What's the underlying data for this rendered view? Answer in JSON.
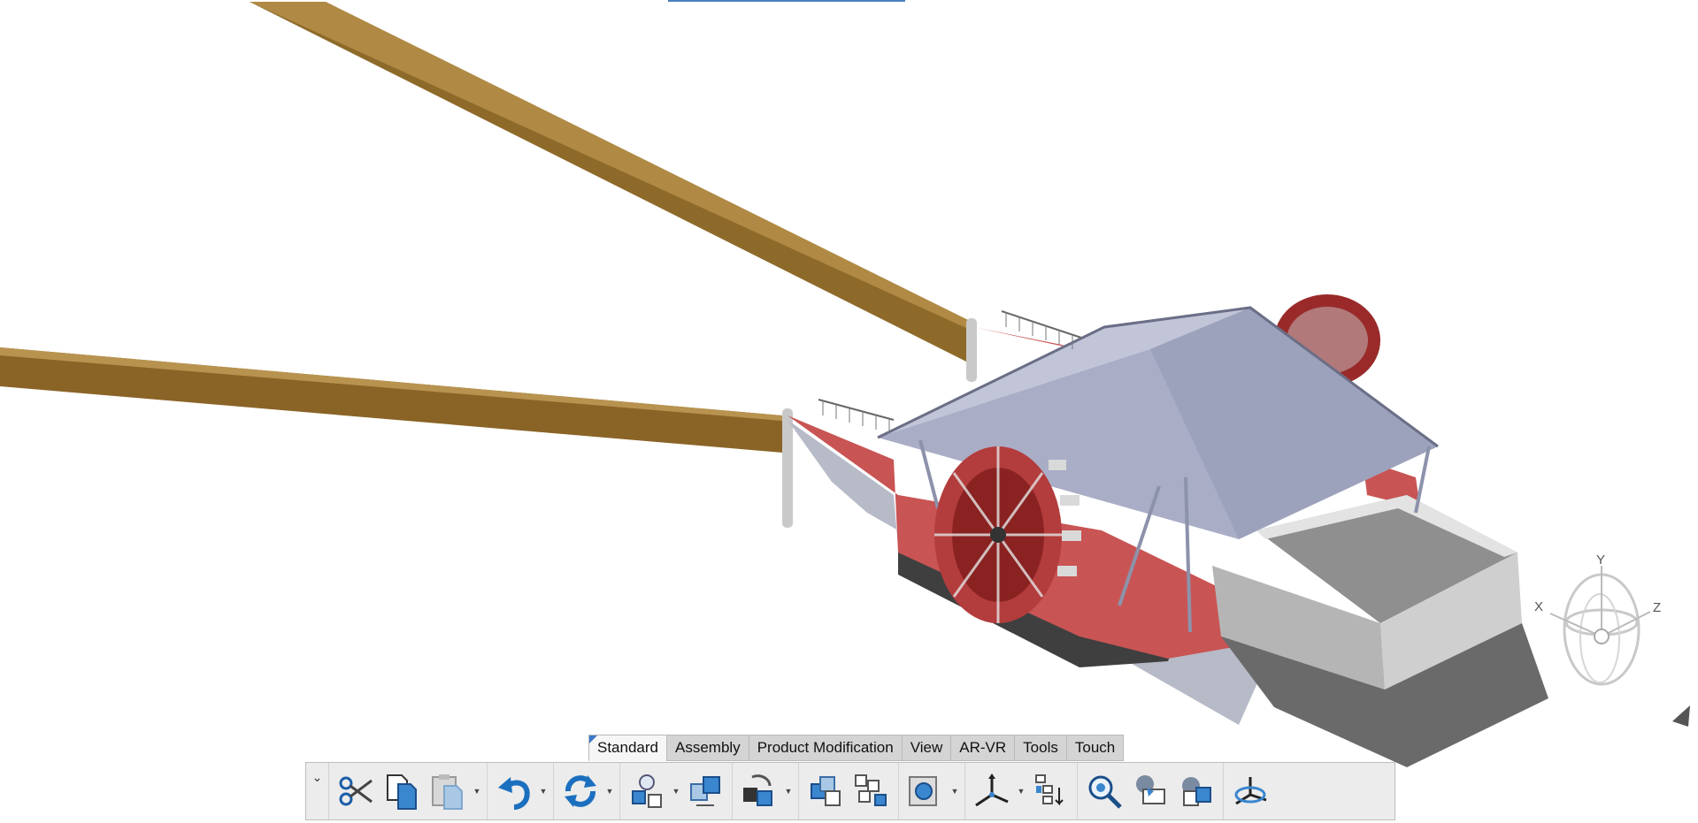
{
  "viewport": {
    "compass": {
      "x_label": "X",
      "y_label": "Y",
      "z_label": "Z"
    }
  },
  "toolbar": {
    "tabs": [
      {
        "label": "Standard",
        "active": true
      },
      {
        "label": "Assembly",
        "active": false
      },
      {
        "label": "Product Modification",
        "active": false
      },
      {
        "label": "View",
        "active": false
      },
      {
        "label": "AR-VR",
        "active": false
      },
      {
        "label": "Tools",
        "active": false
      },
      {
        "label": "Touch",
        "active": false
      }
    ],
    "buttons": [
      {
        "icon": "cut-icon"
      },
      {
        "icon": "copy-icon"
      },
      {
        "icon": "paste-icon"
      },
      {
        "icon": "undo-icon"
      },
      {
        "icon": "update-icon"
      },
      {
        "icon": "insert-component-icon"
      },
      {
        "icon": "explode-icon"
      },
      {
        "icon": "manipulate-icon"
      },
      {
        "icon": "assembly-icon"
      },
      {
        "icon": "structure-icon"
      },
      {
        "icon": "section-icon"
      },
      {
        "icon": "axis-icon"
      },
      {
        "icon": "tree-reorder-icon"
      },
      {
        "icon": "fit-all-icon"
      },
      {
        "icon": "clash-icon"
      },
      {
        "icon": "measure-icon"
      },
      {
        "icon": "rotate-view-icon"
      }
    ]
  },
  "colors": {
    "beam": "#8e6a2a",
    "hull_red": "#c95454",
    "roof": "#a9adc6",
    "tank": "#cfcfcf",
    "tab_active_accent": "#3d78c7"
  }
}
